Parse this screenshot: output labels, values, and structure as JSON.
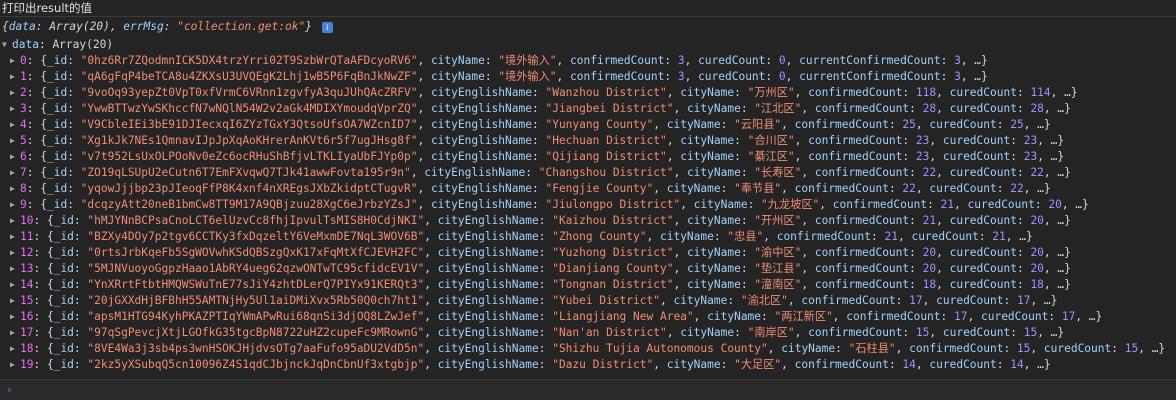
{
  "header": {
    "title": "打印出result的值"
  },
  "summary": {
    "open": "{",
    "data_key": "data",
    "data_val": "Array(20)",
    "sep": ", ",
    "err_key": "errMsg",
    "err_val": "\"collection.get:ok\"",
    "close": "}",
    "info": "i"
  },
  "data_header": {
    "key": "data",
    "value": "Array(20)"
  },
  "rows": [
    {
      "idx": "0",
      "id": "\"0hz6Rr7ZQodmnICK5DX4trzYrri02T9SzbWrQTaAFDcyoRV6\"",
      "segs": [
        [
          "cityName",
          "\"境外输入\""
        ],
        [
          "confirmedCount",
          "3"
        ],
        [
          "curedCount",
          "0"
        ],
        [
          "currentConfirmedCount",
          "3"
        ]
      ]
    },
    {
      "idx": "1",
      "id": "\"qA6gFqP4beTCA8u4ZKXsU3UVQEgK2Lhj1wB5P6FqBnJkNwZF\"",
      "segs": [
        [
          "cityName",
          "\"境外输入\""
        ],
        [
          "confirmedCount",
          "3"
        ],
        [
          "curedCount",
          "0"
        ],
        [
          "currentConfirmedCount",
          "3"
        ]
      ]
    },
    {
      "idx": "2",
      "id": "\"9voOq93yepZt0VpT0xfVrmC6VRnn1zgvfyA3quJUhQAcZRFV\"",
      "segs": [
        [
          "cityEnglishName",
          "\"Wanzhou District\""
        ],
        [
          "cityName",
          "\"万州区\""
        ],
        [
          "confirmedCount",
          "118"
        ],
        [
          "curedCount",
          "114"
        ]
      ]
    },
    {
      "idx": "3",
      "id": "\"YwwBTTwzYwSKhccfN7wNQlN54W2v2aGk4MDIXYmoudqVprZQ\"",
      "segs": [
        [
          "cityEnglishName",
          "\"Jiangbei District\""
        ],
        [
          "cityName",
          "\"江北区\""
        ],
        [
          "confirmedCount",
          "28"
        ],
        [
          "curedCount",
          "28"
        ]
      ]
    },
    {
      "idx": "4",
      "id": "\"V9CbleIEi3bE91DJIecxqI6ZYzTGxY3QtsoUfsOA7WZcnID7\"",
      "segs": [
        [
          "cityEnglishName",
          "\"Yunyang County\""
        ],
        [
          "cityName",
          "\"云阳县\""
        ],
        [
          "confirmedCount",
          "25"
        ],
        [
          "curedCount",
          "25"
        ]
      ]
    },
    {
      "idx": "5",
      "id": "\"Xg1kJk7NEs1QmnavIJpJpXqAoKHrerAnKVt6r5f7ugJHsg8f\"",
      "segs": [
        [
          "cityEnglishName",
          "\"Hechuan District\""
        ],
        [
          "cityName",
          "\"合川区\""
        ],
        [
          "confirmedCount",
          "23"
        ],
        [
          "curedCount",
          "23"
        ]
      ]
    },
    {
      "idx": "6",
      "id": "\"v7t952LsUxOLPOoNv0eZc6ocRHuShBfjvLTKLIyaUbFJYp0p\"",
      "segs": [
        [
          "cityEnglishName",
          "\"Qijiang District\""
        ],
        [
          "cityName",
          "\"綦江区\""
        ],
        [
          "confirmedCount",
          "23"
        ],
        [
          "curedCount",
          "23"
        ]
      ]
    },
    {
      "idx": "7",
      "id": "\"ZO19qLSUpU2eCutn6T7EmFXvqwQ7TJk41awwFovta195r9n\"",
      "segs": [
        [
          "cityEnglishName",
          "\"Changshou District\""
        ],
        [
          "cityName",
          "\"长寿区\""
        ],
        [
          "confirmedCount",
          "22"
        ],
        [
          "curedCount",
          "22"
        ]
      ]
    },
    {
      "idx": "8",
      "id": "\"yqowJjjbp23pJIeoqFfP8K4xnf4nXREgsJXbZkidptCTugvR\"",
      "segs": [
        [
          "cityEnglishName",
          "\"Fengjie County\""
        ],
        [
          "cityName",
          "\"奉节县\""
        ],
        [
          "confirmedCount",
          "22"
        ],
        [
          "curedCount",
          "22"
        ]
      ]
    },
    {
      "idx": "9",
      "id": "\"dcqzyAtt20neB1bmCw8TT9M17A9QBjzuu28XgC6eJrbzYZsJ\"",
      "segs": [
        [
          "cityEnglishName",
          "\"Jiulongpo District\""
        ],
        [
          "cityName",
          "\"九龙坡区\""
        ],
        [
          "confirmedCount",
          "21"
        ],
        [
          "curedCount",
          "20"
        ]
      ]
    },
    {
      "idx": "10",
      "id": "\"hMJYNnBCPsaCnoLCT6elUzvCc8fhjIpvulTsMIS8H0CdjNKI\"",
      "segs": [
        [
          "cityEnglishName",
          "\"Kaizhou District\""
        ],
        [
          "cityName",
          "\"开州区\""
        ],
        [
          "confirmedCount",
          "21"
        ],
        [
          "curedCount",
          "20"
        ]
      ]
    },
    {
      "idx": "11",
      "id": "\"BZXy4DOy7p2tgv6CCTKy3fxDqzeltY6VeMxmDE7NqL3WOV6B\"",
      "segs": [
        [
          "cityEnglishName",
          "\"Zhong County\""
        ],
        [
          "cityName",
          "\"忠县\""
        ],
        [
          "confirmedCount",
          "21"
        ],
        [
          "curedCount",
          "21"
        ]
      ]
    },
    {
      "idx": "12",
      "id": "\"0rtsJrbKqeFb5SgWOVwhKSdQBSzgQxK17xFqMtXfCJEVH2FC\"",
      "segs": [
        [
          "cityEnglishName",
          "\"Yuzhong District\""
        ],
        [
          "cityName",
          "\"渝中区\""
        ],
        [
          "confirmedCount",
          "20"
        ],
        [
          "curedCount",
          "20"
        ]
      ]
    },
    {
      "idx": "13",
      "id": "\"5MJNVuoyoGgpzHaao1AbRY4ueg62qzwONTwTC95cfidcEV1V\"",
      "segs": [
        [
          "cityEnglishName",
          "\"Dianjiang County\""
        ],
        [
          "cityName",
          "\"垫江县\""
        ],
        [
          "confirmedCount",
          "20"
        ],
        [
          "curedCount",
          "20"
        ]
      ]
    },
    {
      "idx": "14",
      "id": "\"YnXRrtFtbtHMQWSWuTnE77sJiY4zhtDLerQ7PIYx91KERQt3\"",
      "segs": [
        [
          "cityEnglishName",
          "\"Tongnan District\""
        ],
        [
          "cityName",
          "\"潼南区\""
        ],
        [
          "confirmedCount",
          "18"
        ],
        [
          "curedCount",
          "18"
        ]
      ]
    },
    {
      "idx": "15",
      "id": "\"20jGXXdHjBFBhH55AMTNjHy5Ul1aiDMiXvx5Rb50Q0ch7ht1\"",
      "segs": [
        [
          "cityEnglishName",
          "\"Yubei District\""
        ],
        [
          "cityName",
          "\"渝北区\""
        ],
        [
          "confirmedCount",
          "17"
        ],
        [
          "curedCount",
          "17"
        ]
      ]
    },
    {
      "idx": "16",
      "id": "\"apsM1HTG94KyhPKAZPTIqYWmAPwRui68qnSi3djOQ8LZwJef\"",
      "segs": [
        [
          "cityEnglishName",
          "\"Liangjiang New Area\""
        ],
        [
          "cityName",
          "\"两江新区\""
        ],
        [
          "confirmedCount",
          "17"
        ],
        [
          "curedCount",
          "17"
        ]
      ]
    },
    {
      "idx": "17",
      "id": "\"97qSgPevcjXtjLGOfkG35tgcBpN8722uHZ2cupeFc9MRownG\"",
      "segs": [
        [
          "cityEnglishName",
          "\"Nan'an District\""
        ],
        [
          "cityName",
          "\"南岸区\""
        ],
        [
          "confirmedCount",
          "15"
        ],
        [
          "curedCount",
          "15"
        ]
      ]
    },
    {
      "idx": "18",
      "id": "\"8VE4Wa3j3sb4ps3wnHSOKJHjdvsOTg7aaFufo95aDU2VdD5n\"",
      "segs": [
        [
          "cityEnglishName",
          "\"Shizhu Tujia Autonomous County\""
        ],
        [
          "cityName",
          "\"石柱县\""
        ],
        [
          "confirmedCount",
          "15"
        ],
        [
          "curedCount",
          "15"
        ]
      ]
    },
    {
      "idx": "19",
      "id": "\"2kz5yXSubqQ5cn10096Z4S1qdCJbjnckJqDnCbnUf3xtgbjp\"",
      "segs": [
        [
          "cityEnglishName",
          "\"Dazu District\""
        ],
        [
          "cityName",
          "\"大足区\""
        ],
        [
          "confirmedCount",
          "14"
        ],
        [
          "curedCount",
          "14"
        ]
      ]
    }
  ],
  "colors": {
    "background": "#242424",
    "key": "#a1d1f9",
    "index": "#e36eec",
    "string": "#f08d72",
    "number": "#9f91ff"
  },
  "icons": {
    "expand": "triangle-down-icon",
    "collapse": "triangle-right-icon",
    "prompt": "chevron-right-icon"
  }
}
